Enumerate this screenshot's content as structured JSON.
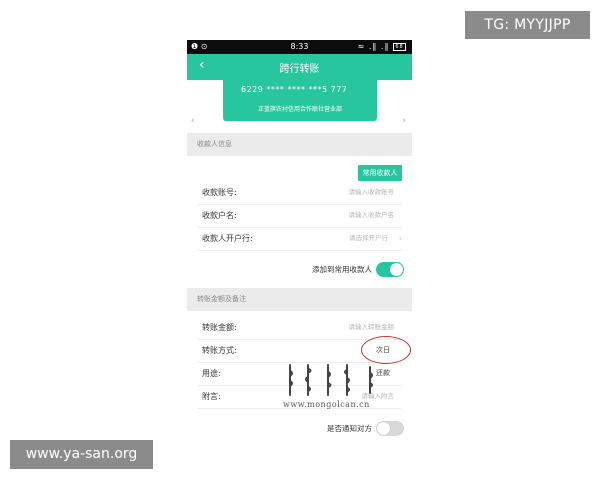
{
  "watermark_top": "TG: MYYJJPP",
  "watermark_bottom": "www.ya-san.org",
  "statusbar": {
    "time": "8:33",
    "left": "❶ ⊙",
    "signal": "≈ .∥ .∥",
    "battery": "68"
  },
  "titlebar": {
    "back": "‹",
    "title": "跨行转账"
  },
  "card": {
    "number": "6229 **** **** ***5 777",
    "bank": "正蓝旗农村信用合作联社营业部"
  },
  "payee_section": {
    "title": "收款人信息",
    "fav_button": "常用收款人",
    "rows": [
      {
        "label": "收款账号:",
        "placeholder": "请输入收款账号"
      },
      {
        "label": "收款户名:",
        "placeholder": "请输入收款户名"
      },
      {
        "label": "收款人开户行:",
        "placeholder": "请选择开户行"
      }
    ],
    "add_fav_label": "添加到常用收款人"
  },
  "amount_section": {
    "title": "转账金额及备注",
    "rows": [
      {
        "label": "转账金额:",
        "placeholder": "请输入转账金额"
      },
      {
        "label": "转账方式:",
        "value": "次日"
      },
      {
        "label": "用途:",
        "value": "还款"
      },
      {
        "label": "附言:",
        "placeholder": "请输入附言"
      }
    ],
    "notify_label": "是否通知对方"
  },
  "overlay_url": "www.mongolcan.cn",
  "colors": {
    "accent": "#28c69e",
    "annotation": "#c0392b"
  }
}
